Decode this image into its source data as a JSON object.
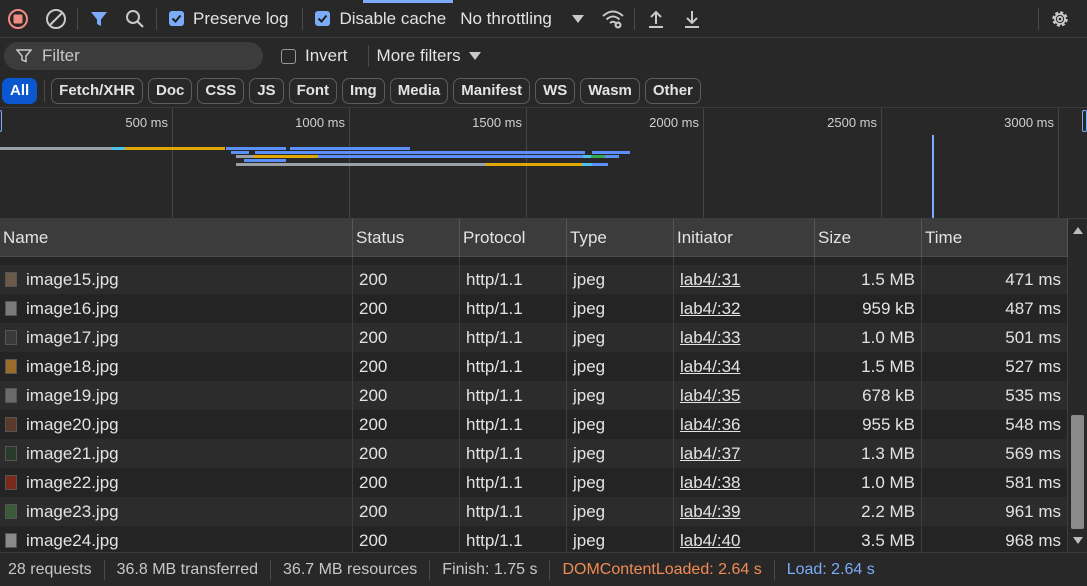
{
  "toolbar": {
    "preserve_log": {
      "label": "Preserve log",
      "checked": true
    },
    "disable_cache": {
      "label": "Disable cache",
      "checked": true
    },
    "throttling": "No throttling",
    "icons": [
      "record-stop-icon",
      "clear-icon",
      "filter-icon",
      "search-icon",
      "network-conditions-icon",
      "import-icon",
      "export-icon",
      "settings-icon"
    ]
  },
  "filter": {
    "placeholder": "Filter",
    "invert_label": "Invert",
    "more_filters_label": "More filters"
  },
  "type_filters": [
    "All",
    "Fetch/XHR",
    "Doc",
    "CSS",
    "JS",
    "Font",
    "Img",
    "Media",
    "Manifest",
    "WS",
    "Wasm",
    "Other"
  ],
  "active_type_filter": "All",
  "overview": {
    "tick_labels": [
      "500 ms",
      "1000 ms",
      "1500 ms",
      "2000 ms",
      "2500 ms",
      "3000 ms"
    ],
    "colors": {
      "blue": "#5b8ff9",
      "gold": "#e0a800",
      "grey": "#9aa0a6",
      "teal": "#4cc2e8",
      "green": "#34a853"
    }
  },
  "table": {
    "columns": [
      "Name",
      "Status",
      "Protocol",
      "Type",
      "Initiator",
      "Size",
      "Time"
    ],
    "rows": [
      {
        "name": "image15.jpg",
        "status": "200",
        "protocol": "http/1.1",
        "type": "jpeg",
        "initiator": "lab4/:31",
        "size": "1.5 MB",
        "time": "471 ms"
      },
      {
        "name": "image16.jpg",
        "status": "200",
        "protocol": "http/1.1",
        "type": "jpeg",
        "initiator": "lab4/:32",
        "size": "959 kB",
        "time": "487 ms"
      },
      {
        "name": "image17.jpg",
        "status": "200",
        "protocol": "http/1.1",
        "type": "jpeg",
        "initiator": "lab4/:33",
        "size": "1.0 MB",
        "time": "501 ms"
      },
      {
        "name": "image18.jpg",
        "status": "200",
        "protocol": "http/1.1",
        "type": "jpeg",
        "initiator": "lab4/:34",
        "size": "1.5 MB",
        "time": "527 ms"
      },
      {
        "name": "image19.jpg",
        "status": "200",
        "protocol": "http/1.1",
        "type": "jpeg",
        "initiator": "lab4/:35",
        "size": "678 kB",
        "time": "535 ms"
      },
      {
        "name": "image20.jpg",
        "status": "200",
        "protocol": "http/1.1",
        "type": "jpeg",
        "initiator": "lab4/:36",
        "size": "955 kB",
        "time": "548 ms"
      },
      {
        "name": "image21.jpg",
        "status": "200",
        "protocol": "http/1.1",
        "type": "jpeg",
        "initiator": "lab4/:37",
        "size": "1.3 MB",
        "time": "569 ms"
      },
      {
        "name": "image22.jpg",
        "status": "200",
        "protocol": "http/1.1",
        "type": "jpeg",
        "initiator": "lab4/:38",
        "size": "1.0 MB",
        "time": "581 ms"
      },
      {
        "name": "image23.jpg",
        "status": "200",
        "protocol": "http/1.1",
        "type": "jpeg",
        "initiator": "lab4/:39",
        "size": "2.2 MB",
        "time": "961 ms"
      },
      {
        "name": "image24.jpg",
        "status": "200",
        "protocol": "http/1.1",
        "type": "jpeg",
        "initiator": "lab4/:40",
        "size": "3.5 MB",
        "time": "968 ms"
      }
    ]
  },
  "status_bar": {
    "requests": "28 requests",
    "transferred": "36.8 MB transferred",
    "resources": "36.7 MB resources",
    "finish": "Finish: 1.75 s",
    "dom_content_loaded": "DOMContentLoaded: 2.64 s",
    "load": "Load: 2.64 s",
    "dcl_color": "#f28b54",
    "load_color": "#7cacf8"
  }
}
